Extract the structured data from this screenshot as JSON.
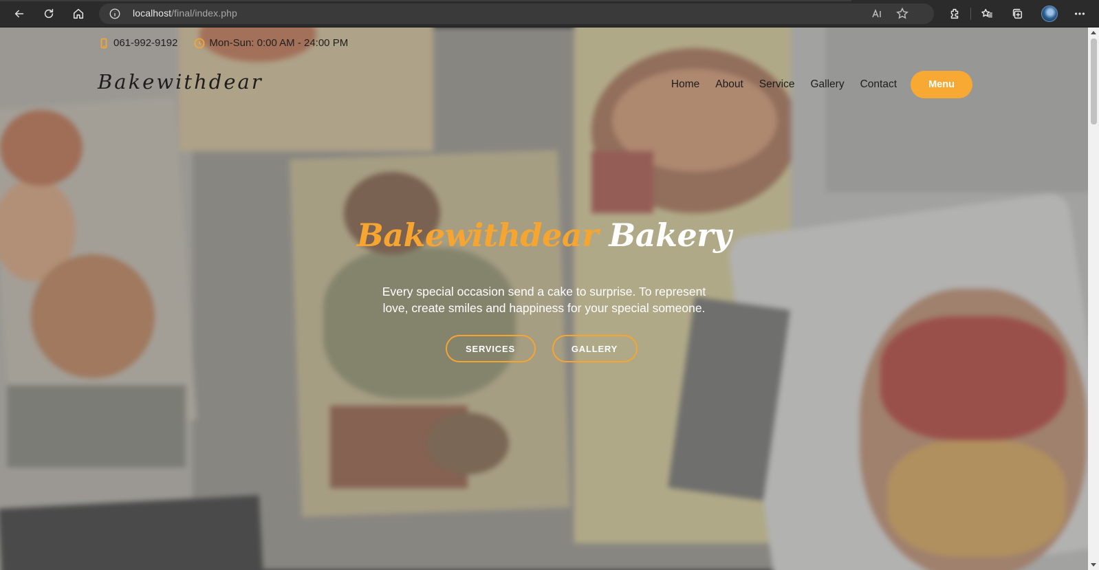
{
  "browser": {
    "url_host": "localhost",
    "url_path": "/final/index.php",
    "icons": [
      "back-icon",
      "refresh-icon",
      "home-icon",
      "info-icon",
      "read-aloud-icon",
      "add-favorite-icon",
      "extensions-icon",
      "favorites-icon",
      "collections-icon",
      "profile-avatar",
      "more-icon"
    ]
  },
  "topbar": {
    "phone": "061-992-9192",
    "hours": "Mon-Sun: 0:00 AM - 24:00 PM"
  },
  "navbar": {
    "logo": "Bakewithdear",
    "links": [
      "Home",
      "About",
      "Service",
      "Gallery",
      "Contact"
    ],
    "menu_button": "Menu"
  },
  "hero": {
    "title_accent": "Bakewithdear",
    "title_rest": "Bakery",
    "subtitle_line1": "Every special occasion send a cake to surprise. To represent",
    "subtitle_line2": "love, create smiles and happiness for your special someone.",
    "button_services": "SERVICES",
    "button_gallery": "GALLERY"
  },
  "colors": {
    "accent": "#f7a531",
    "text_dark": "#1d1d1d",
    "text_light": "#ffffff"
  }
}
